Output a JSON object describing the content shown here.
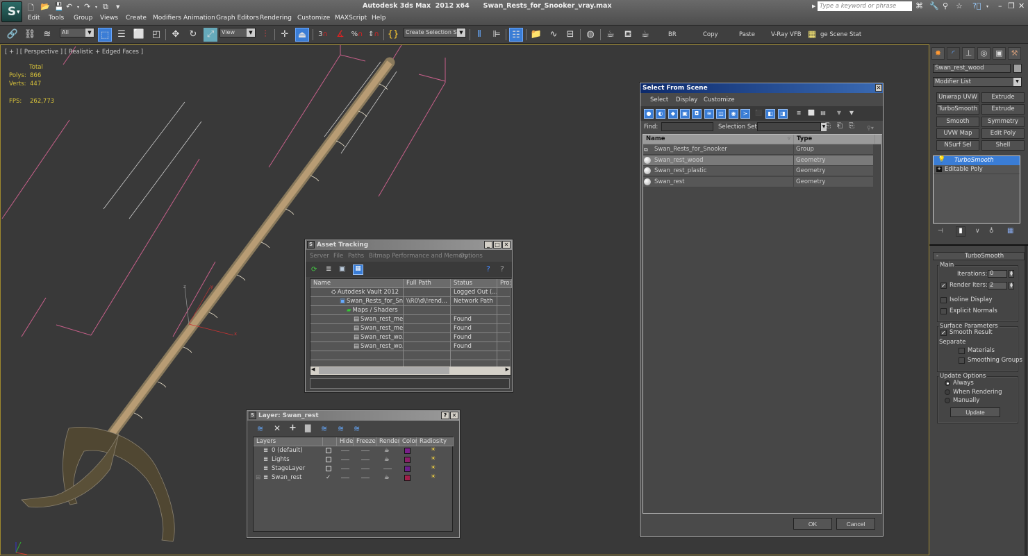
{
  "app": {
    "title": "Autodesk 3ds Max  2012 x64      Swan_Rests_for_Snooker_vray.max",
    "logo": "S",
    "search_placeholder": "Type a keyword or phrase"
  },
  "menu": [
    "Edit",
    "Tools",
    "Group",
    "Views",
    "Create",
    "Modifiers",
    "Animation",
    "Graph Editors",
    "Rendering",
    "Customize",
    "MAXScript",
    "Help"
  ],
  "toolbar": {
    "filter_value": "All",
    "reference_coord_value": "View",
    "snap_label": "3",
    "selection_set_value": "Create Selection Se",
    "buttons": [
      "BR",
      "Copy",
      "Paste",
      "V-Ray VFB",
      "ge Scene Stat"
    ]
  },
  "viewport": {
    "label": "[ + ] [ Perspective ] [ Realistic + Edged Faces ]",
    "stats": {
      "total_label": "Total",
      "polys_label": "Polys:",
      "polys": "866",
      "verts_label": "Verts:",
      "verts": "447",
      "fps_label": "FPS:",
      "fps": "262,773"
    },
    "gizmo": {
      "x": "x",
      "y": "y",
      "z": "z"
    }
  },
  "asset_tracking": {
    "title": "Asset Tracking",
    "menu": [
      "Server",
      "File",
      "Paths",
      "Bitmap Performance and Memory",
      "Options"
    ],
    "columns": [
      "Name",
      "Full Path",
      "Status",
      "Pro:"
    ],
    "rows": [
      {
        "name": "Autodesk Vault 2012",
        "path": "",
        "status": "Logged Out (..."
      },
      {
        "name": "Swan_Rests_for_Sno...",
        "path": "\\\\R0\\d\\!rend...",
        "status": "Network Path"
      },
      {
        "name": "Maps / Shaders",
        "path": "",
        "status": ""
      },
      {
        "name": "Swan_rest_me...",
        "path": "",
        "status": "Found"
      },
      {
        "name": "Swan_rest_me...",
        "path": "",
        "status": "Found"
      },
      {
        "name": "Swan_rest_wo...",
        "path": "",
        "status": "Found"
      },
      {
        "name": "Swan_rest_wo...",
        "path": "",
        "status": "Found"
      }
    ]
  },
  "layer_dialog": {
    "title": "Layer: Swan_rest",
    "columns": [
      "Layers",
      "",
      "Hide",
      "Freeze",
      "Render",
      "Color",
      "Radiosity"
    ],
    "rows": [
      {
        "name": "0 (default)",
        "current": "",
        "color": "#7a1f8a"
      },
      {
        "name": "Lights",
        "current": "",
        "color": "#8a1f6a"
      },
      {
        "name": "StageLayer",
        "current": "",
        "color": "#6a1f8a"
      },
      {
        "name": "Swan_rest",
        "current": "✓",
        "color": "#a01f4a"
      }
    ]
  },
  "select_from_scene": {
    "title": "Select From Scene",
    "menu": [
      "Select",
      "Display",
      "Customize"
    ],
    "find_label": "Find:",
    "find_value": "",
    "selection_set_label": "Selection Set:",
    "selection_set_value": "",
    "columns": [
      "Name",
      "Type"
    ],
    "rows": [
      {
        "name": "Swan_Rests_for_Snooker",
        "type": "Group",
        "selected": false
      },
      {
        "name": "Swan_rest_wood",
        "type": "Geometry",
        "selected": true
      },
      {
        "name": "Swan_rest_plastic",
        "type": "Geometry",
        "selected": false
      },
      {
        "name": "Swan_rest",
        "type": "Geometry",
        "selected": false
      }
    ],
    "ok_label": "OK",
    "cancel_label": "Cancel"
  },
  "command_panel": {
    "object_name": "Swan_rest_wood",
    "object_color": "#a0a0a0",
    "modifier_list": "Modifier List",
    "modifier_buttons": [
      "Unwrap UVW",
      "Extrude",
      "TurboSmooth",
      "Extrude",
      "Smooth",
      "Symmetry",
      "UVW Map",
      "Edit Poly",
      "NSurf Sel",
      "Shell"
    ],
    "stack": [
      "TurboSmooth",
      "Editable Poly"
    ],
    "rollout_title": "TurboSmooth",
    "main_group": "Main",
    "iterations_label": "Iterations:",
    "iterations": "0",
    "render_iters_label": "Render Iters:",
    "render_iters": "2",
    "render_iters_checked": true,
    "isoline_label": "Isoline Display",
    "isoline_checked": false,
    "explicit_normals_label": "Explicit Normals",
    "explicit_normals_checked": false,
    "surface_group": "Surface Parameters",
    "smooth_result_label": "Smooth Result",
    "smooth_result_checked": true,
    "separate_label": "Separate",
    "materials_label": "Materials",
    "materials_checked": false,
    "smoothing_groups_label": "Smoothing Groups",
    "smoothing_groups_checked": false,
    "update_group": "Update Options",
    "update_options": [
      "Always",
      "When Rendering",
      "Manually"
    ],
    "update_selected": "Always",
    "update_button": "Update"
  }
}
